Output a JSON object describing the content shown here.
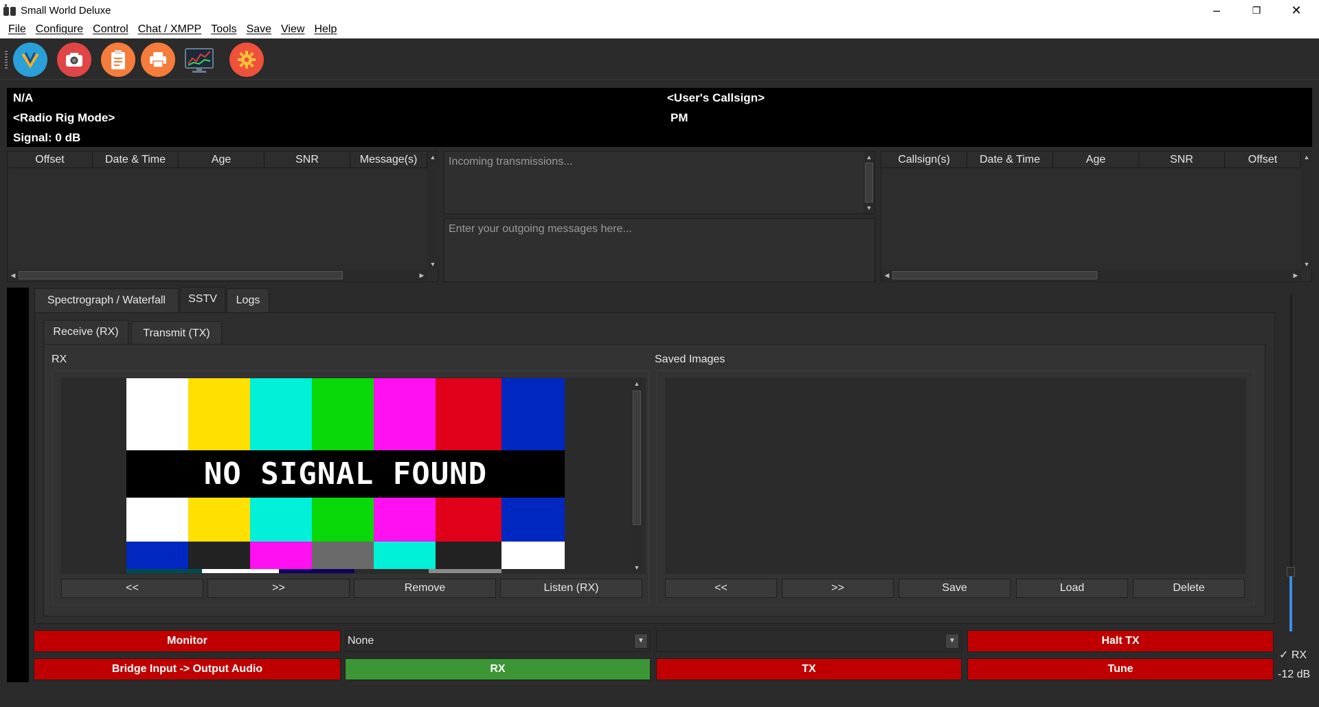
{
  "window": {
    "title": "Small World Deluxe",
    "controls": [
      "–",
      "❐",
      "✕"
    ]
  },
  "menu": [
    "File",
    "Configure",
    "Control",
    "Chat / XMPP",
    "Tools",
    "Save",
    "View",
    "Help"
  ],
  "toolbar": {
    "buttons": [
      "vertical-icon",
      "camera-icon",
      "clipboard-icon",
      "printer-icon",
      "chart-monitor-icon",
      "settings-gear-icon"
    ]
  },
  "info": {
    "frequency": "N/A",
    "rig_mode": "<Radio Rig Mode>",
    "signal": "Signal: 0 dB",
    "callsign": "<User's Callsign>",
    "time": "PM"
  },
  "left_table": {
    "columns": [
      "Offset",
      "Date & Time",
      "Age",
      "SNR",
      "Message(s)"
    ]
  },
  "right_table": {
    "columns": [
      "Callsign(s)",
      "Date & Time",
      "Age",
      "SNR",
      "Offset"
    ]
  },
  "messages": {
    "incoming_placeholder": "Incoming transmissions...",
    "outgoing_placeholder": "Enter your outgoing messages here..."
  },
  "main_tabs": [
    "Spectrograph / Waterfall",
    "SSTV",
    "Logs"
  ],
  "sstv_tabs": [
    "Receive (RX)",
    "Transmit (TX)"
  ],
  "rx": {
    "label": "RX",
    "no_signal": "NO SIGNAL FOUND",
    "buttons": [
      "<<",
      ">>",
      "Remove",
      "Listen (RX)"
    ]
  },
  "saved": {
    "label": "Saved Images",
    "buttons": [
      "<<",
      ">>",
      "Save",
      "Load",
      "Delete"
    ]
  },
  "controls": {
    "monitor": "Monitor",
    "bridge": "Bridge Input -> Output Audio",
    "input_combo": "None",
    "output_combo": "",
    "rx": "RX",
    "tx": "TX",
    "halt_tx": "Halt TX",
    "tune": "Tune"
  },
  "meter": {
    "rx_check": "✓ RX",
    "level": "-12 dB"
  },
  "colors": {
    "red_button": "#c00000",
    "green_button": "#3c9635",
    "background": "#2b2b2b"
  }
}
